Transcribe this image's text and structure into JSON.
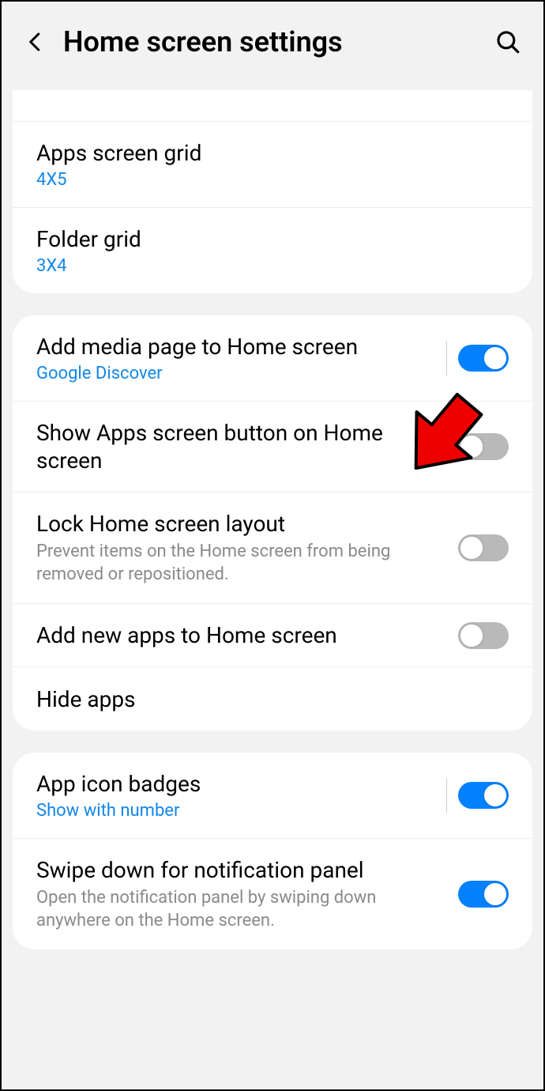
{
  "header": {
    "title": "Home screen settings"
  },
  "group1": {
    "apps_grid": {
      "title": "Apps screen grid",
      "value": "4X5"
    },
    "folder_grid": {
      "title": "Folder grid",
      "value": "3X4"
    }
  },
  "group2": {
    "media_page": {
      "title": "Add media page to Home screen",
      "value": "Google Discover",
      "on": true
    },
    "show_apps_button": {
      "title": "Show Apps screen button on Home screen",
      "on": false
    },
    "lock_layout": {
      "title": "Lock Home screen layout",
      "desc": "Prevent items on the Home screen from being removed or repositioned.",
      "on": false
    },
    "add_new_apps": {
      "title": "Add new apps to Home screen",
      "on": false
    },
    "hide_apps": {
      "title": "Hide apps"
    }
  },
  "group3": {
    "icon_badges": {
      "title": "App icon badges",
      "value": "Show with number",
      "on": true
    },
    "swipe_down": {
      "title": "Swipe down for notification panel",
      "desc": "Open the notification panel by swiping down anywhere on the Home screen.",
      "on": true
    }
  }
}
